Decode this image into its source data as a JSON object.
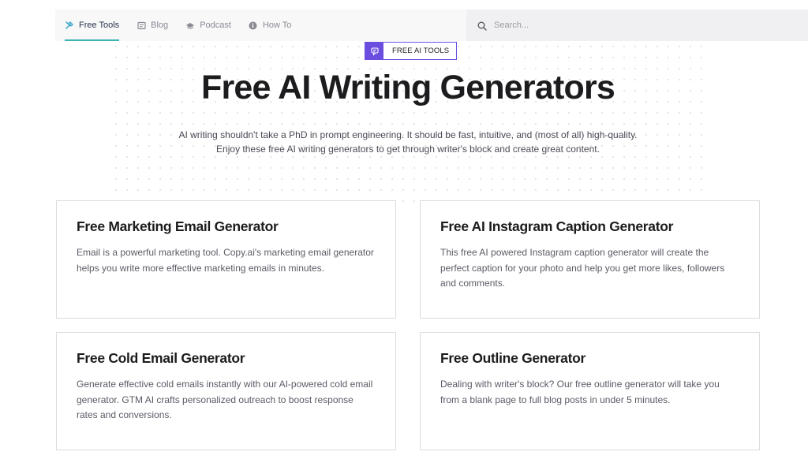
{
  "nav": {
    "items": [
      {
        "label": "Free Tools",
        "icon": "tools-icon",
        "active": true
      },
      {
        "label": "Blog",
        "icon": "blog-icon",
        "active": false
      },
      {
        "label": "Podcast",
        "icon": "podcast-icon",
        "active": false
      },
      {
        "label": "How To",
        "icon": "info-icon",
        "active": false
      }
    ],
    "accent_color": "#3cb4b4"
  },
  "search": {
    "placeholder": "Search...",
    "value": "",
    "icon": "search-icon"
  },
  "badge": {
    "label": "FREE AI TOOLS",
    "icon": "chat-bubble-icon",
    "color": "#6b4de0"
  },
  "hero": {
    "title": "Free AI Writing Generators",
    "subtitle_line1": "AI writing shouldn't take a PhD in prompt engineering. It should be fast, intuitive, and (most of all) high-quality.",
    "subtitle_line2": "Enjoy these free AI writing generators to get through writer's block and create great content."
  },
  "cards": [
    {
      "title": "Free Marketing Email Generator",
      "description": "Email is a powerful marketing tool. Copy.ai's marketing email generator helps you write more effective marketing emails in minutes."
    },
    {
      "title": "Free AI Instagram Caption Generator",
      "description": "This free AI powered Instagram caption generator will create the perfect caption for your photo and help you get more likes, followers and comments."
    },
    {
      "title": "Free Cold Email Generator",
      "description": "Generate effective cold emails instantly with our AI-powered cold email generator. GTM AI crafts personalized outreach to boost response rates and conversions."
    },
    {
      "title": "Free Outline Generator",
      "description": "Dealing with writer's block? Our free outline generator will take you from a blank page to full blog posts in under 5 minutes."
    }
  ]
}
